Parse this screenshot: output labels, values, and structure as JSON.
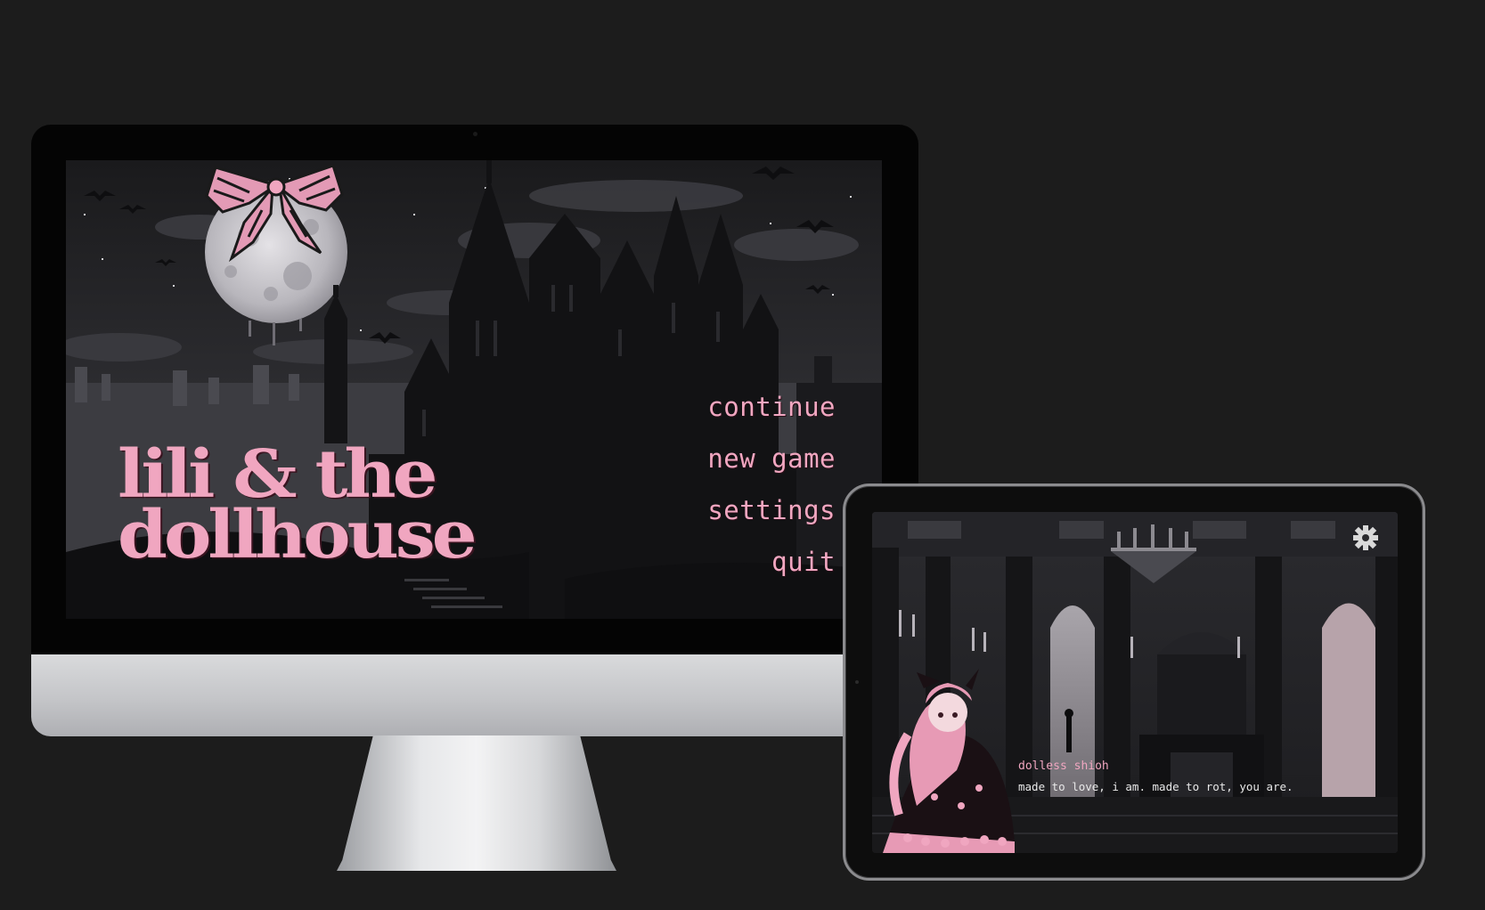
{
  "desktop": {
    "title": {
      "line1": "lili & the",
      "line2": "dollhouse"
    },
    "menu": {
      "items": [
        "continue",
        "new game",
        "settings",
        "quit"
      ]
    }
  },
  "tablet": {
    "dialogue": {
      "speaker": "dolless shioh",
      "text": "made to love, i am. made to rot, you are."
    },
    "settings_icon": "gear-icon"
  },
  "colors": {
    "background": "#1c1c1c",
    "accent_pink": "#f0a6c0",
    "dialogue_text": "#e8e8e8"
  }
}
